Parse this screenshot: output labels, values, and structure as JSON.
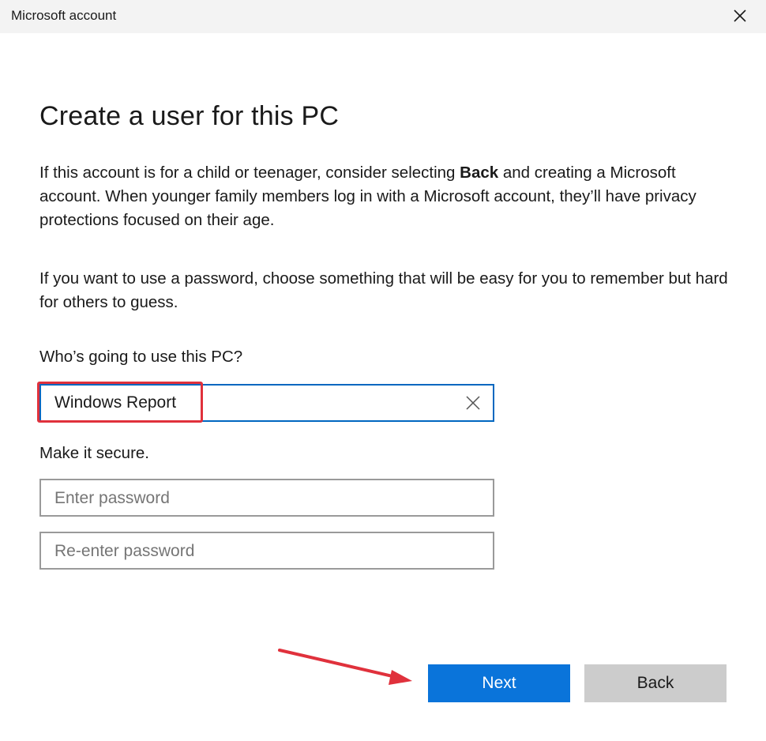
{
  "window": {
    "title": "Microsoft account"
  },
  "page": {
    "heading": "Create a user for this PC",
    "para1_before": "If this account is for a child or teenager, consider selecting ",
    "para1_bold": "Back",
    "para1_after": " and creating a Microsoft account. When younger family members log in with a Microsoft account, they’ll have privacy protections focused on their age.",
    "para2": "If you want to use a password, choose something that will be easy for you to remember but hard for others to guess."
  },
  "form": {
    "user_label": "Who’s going to use this PC?",
    "user_value": "Windows Report",
    "secure_label": "Make it secure.",
    "password_placeholder": "Enter password",
    "repassword_placeholder": "Re-enter password"
  },
  "buttons": {
    "next": "Next",
    "back": "Back"
  },
  "colors": {
    "accent": "#0a74da",
    "highlight": "#e0313c"
  }
}
